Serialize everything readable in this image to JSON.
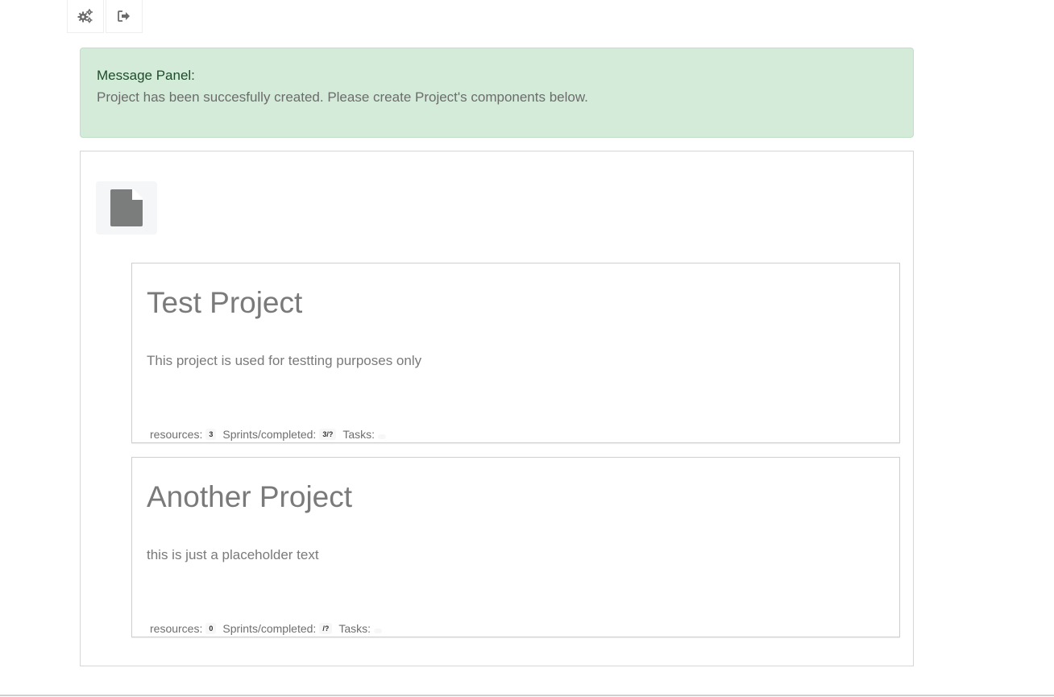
{
  "toolbar": {
    "settings_icon": "gears-icon",
    "logout_icon": "sign-out-icon"
  },
  "message_panel": {
    "title": "Message Panel:",
    "text": "Project has been succesfully created. Please create Project's components below."
  },
  "panel": {
    "icon": "file-icon"
  },
  "projects": [
    {
      "title": "Test Project",
      "description": "This project is used for testting purposes only",
      "resources_label": "resources:",
      "resources_value": "3",
      "sprints_label": "Sprints/completed:",
      "sprints_value": "3/?",
      "tasks_label": "Tasks:",
      "tasks_value": ""
    },
    {
      "title": "Another Project",
      "description": "this is just a placeholder text",
      "resources_label": "resources:",
      "resources_value": "0",
      "sprints_label": "Sprints/completed:",
      "sprints_value": "/?",
      "tasks_label": "Tasks:",
      "tasks_value": ""
    }
  ],
  "colors": {
    "alert_bg": "#d4ebd9",
    "alert_title": "#1d4d2a",
    "text_gray": "#7a7a7a"
  }
}
